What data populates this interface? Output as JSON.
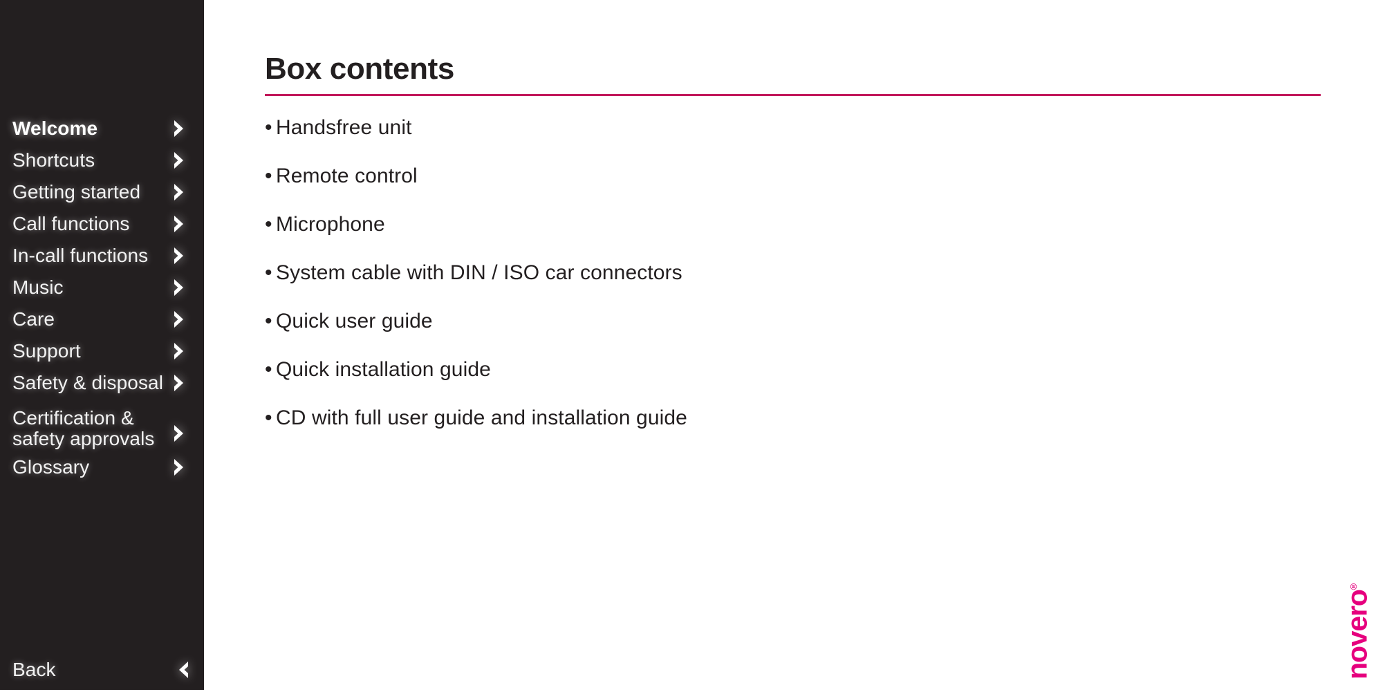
{
  "document": {
    "title": "Box contents"
  },
  "colors": {
    "sidebar_background": "#231F20",
    "sidebar_text": "#F2F2F2",
    "accent_rule": "#C2185B",
    "brand_magenta": "#E6007E",
    "body_text": "#231F20",
    "page_background": "#FFFFFF"
  },
  "sidebar": {
    "items": [
      {
        "label": "Welcome",
        "icon": "chevron-right-icon",
        "active": true,
        "two_line": false
      },
      {
        "label": "Shortcuts",
        "icon": "chevron-right-icon",
        "active": false,
        "two_line": false
      },
      {
        "label": "Getting started",
        "icon": "chevron-right-icon",
        "active": false,
        "two_line": false
      },
      {
        "label": "Call functions",
        "icon": "chevron-right-icon",
        "active": false,
        "two_line": false
      },
      {
        "label": "In-call functions",
        "icon": "chevron-right-icon",
        "active": false,
        "two_line": false
      },
      {
        "label": "Music",
        "icon": "chevron-right-icon",
        "active": false,
        "two_line": false
      },
      {
        "label": "Care",
        "icon": "chevron-right-icon",
        "active": false,
        "two_line": false
      },
      {
        "label": "Support",
        "icon": "chevron-right-icon",
        "active": false,
        "two_line": false
      },
      {
        "label": "Safety & disposal",
        "icon": "chevron-right-icon",
        "active": false,
        "two_line": false
      },
      {
        "label": "Certification &\nsafety approvals",
        "icon": "chevron-right-icon",
        "active": false,
        "two_line": true
      },
      {
        "label": "Glossary",
        "icon": "chevron-right-icon",
        "active": false,
        "two_line": false
      }
    ],
    "back": {
      "label": "Back",
      "icon": "chevron-left-icon"
    }
  },
  "main": {
    "heading": "Box contents",
    "bullet_char": "•",
    "bullets": [
      "Handsfree unit",
      "Remote control",
      "Microphone",
      "System cable with DIN / ISO car connectors",
      "Quick user guide",
      "Quick installation guide",
      "CD with full user guide and installation guide"
    ]
  },
  "logo": {
    "text": "novero",
    "trademark": "®",
    "orientation": "rotated-90-ccw"
  }
}
